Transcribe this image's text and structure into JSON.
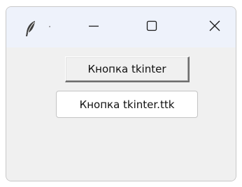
{
  "window": {
    "title_text": "·",
    "app_icon": "feather-icon",
    "controls": {
      "minimize_icon": "minimize-icon",
      "maximize_icon": "maximize-icon",
      "close_icon": "close-icon"
    },
    "colors": {
      "titlebar": "#eef2fb",
      "content_bg": "#f0f0f0"
    }
  },
  "content": {
    "tk_button_label": "Кнопка tkinter",
    "ttk_button_label": "Кнопка tkinter.ttk"
  }
}
